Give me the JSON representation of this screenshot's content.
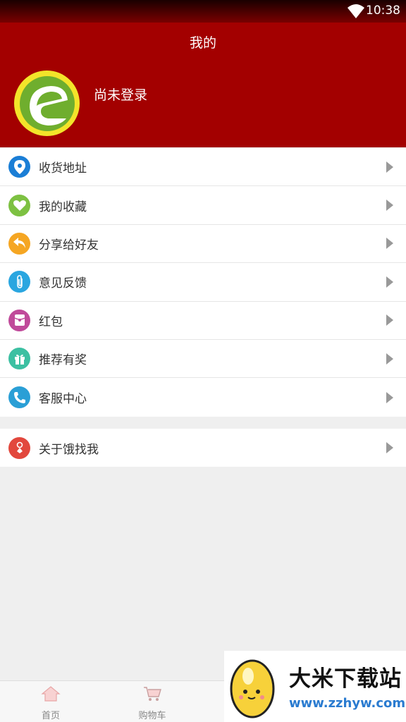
{
  "status_bar": {
    "time": "10:38"
  },
  "header": {
    "title": "我的",
    "login_text": "尚未登录"
  },
  "menu": [
    {
      "label": "收货地址",
      "icon": "location-pin-icon",
      "color": "#1a7ed6"
    },
    {
      "label": "我的收藏",
      "icon": "heart-icon",
      "color": "#7dc142"
    },
    {
      "label": "分享给好友",
      "icon": "share-icon",
      "color": "#f5a623"
    },
    {
      "label": "意见反馈",
      "icon": "paperclip-icon",
      "color": "#2aa6e0"
    },
    {
      "label": "红包",
      "icon": "red-envelope-icon",
      "color": "#c04a9a"
    },
    {
      "label": "推荐有奖",
      "icon": "gift-icon",
      "color": "#3cc0a2"
    },
    {
      "label": "客服中心",
      "icon": "phone-icon",
      "color": "#2a9fd6"
    }
  ],
  "menu2": [
    {
      "label": "关于饿找我",
      "icon": "info-icon",
      "color": "#e2483d"
    }
  ],
  "bottom_nav": [
    {
      "label": "首页",
      "icon": "home-icon"
    },
    {
      "label": "购物车",
      "icon": "cart-icon"
    }
  ],
  "watermark": {
    "title": "大米下载站",
    "url": "www.zzhyw.com"
  }
}
